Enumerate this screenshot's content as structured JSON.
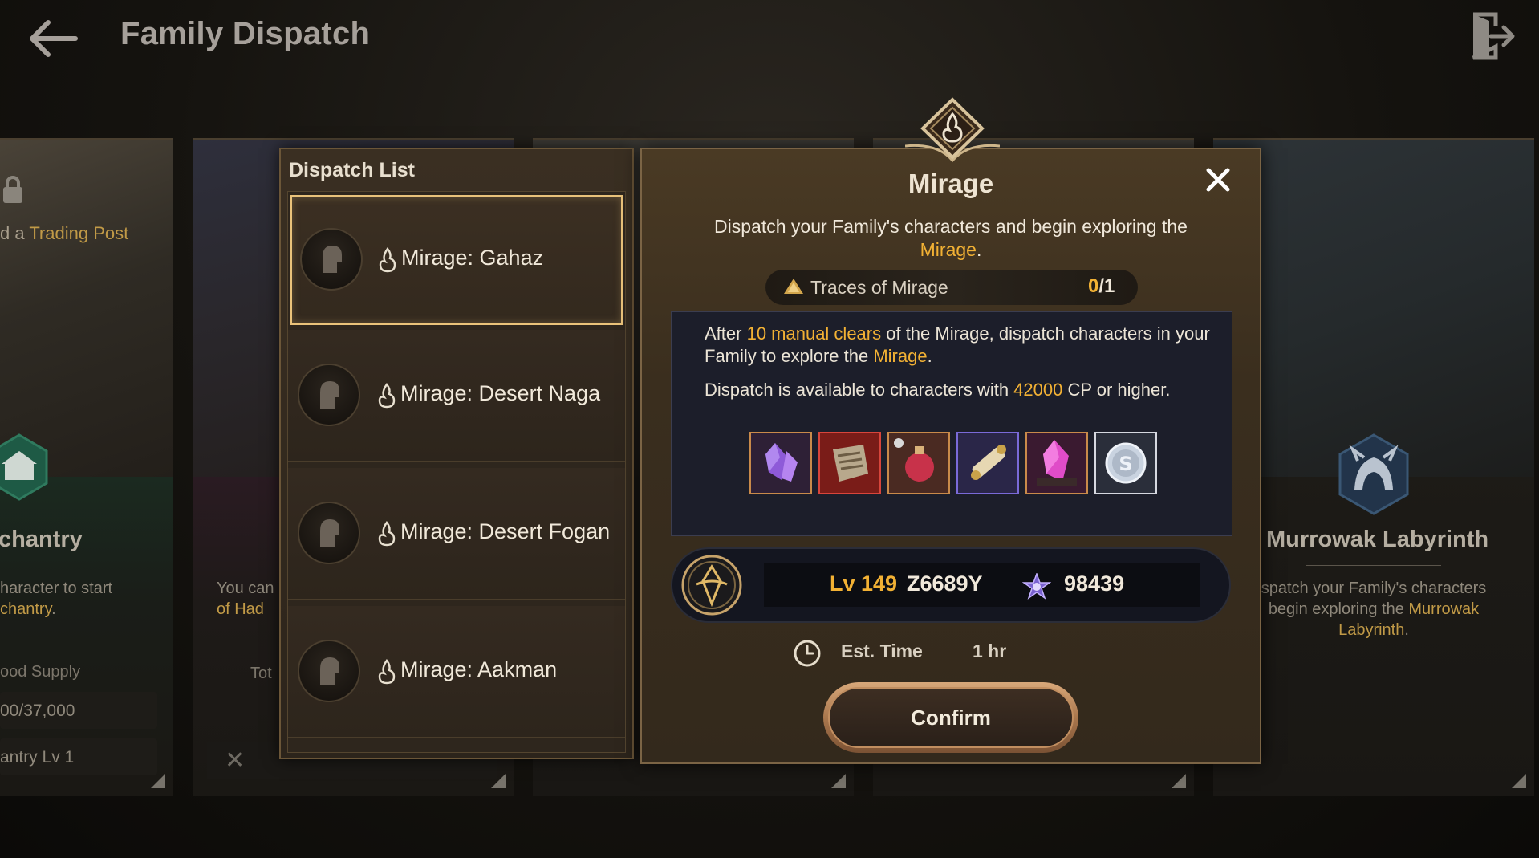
{
  "header": {
    "title": "Family Dispatch"
  },
  "background_cards": {
    "left": {
      "trading_prefix": "d a ",
      "trading_highlight": "Trading Post",
      "name": "chantry",
      "desc_line1": "haracter to start",
      "desc_line2_highlight": "chantry",
      "desc_line2_suffix": ".",
      "food_label": "ood Supply",
      "food_value": "00/37,000",
      "level": "antry Lv 1"
    },
    "middle": {
      "desc_line1_prefix": "You can",
      "desc_line2_prefix": "of Had",
      "tot_label": "Tot"
    },
    "right": {
      "name": "Murrowak Labyrinth",
      "desc_prefix": "spatch your Family's characters begin exploring the ",
      "desc_highlight": "Murrowak Labyrinth",
      "desc_suffix": "."
    }
  },
  "dispatch_list": {
    "title": "Dispatch List",
    "items": [
      {
        "label": "Mirage: Gahaz",
        "selected": true
      },
      {
        "label": "Mirage: Desert Naga",
        "selected": false
      },
      {
        "label": "Mirage: Desert Fogan",
        "selected": false
      },
      {
        "label": "Mirage: Aakman",
        "selected": false
      }
    ]
  },
  "detail": {
    "title": "Mirage",
    "subtitle_prefix": "Dispatch your Family's characters and begin exploring the",
    "subtitle_highlight": "Mirage",
    "subtitle_suffix": ".",
    "traces": {
      "label": "Traces of Mirage",
      "current": "0",
      "total": "/1"
    },
    "info": {
      "line1_prefix": "After ",
      "line1_highlight": "10 manual clears",
      "line1_mid": " of the Mirage, dispatch characters in your Family to explore the ",
      "line1_highlight2": "Mirage",
      "line1_suffix": ".",
      "line2_prefix": "Dispatch is available to characters with ",
      "line2_highlight": "42000",
      "line2_suffix": " CP or higher."
    },
    "rewards": [
      {
        "icon": "purple-crystal-icon",
        "border": "#c98a4a"
      },
      {
        "icon": "ancient-relic-icon",
        "border": "#d8453b"
      },
      {
        "icon": "red-potion-icon",
        "border": "#c98a4a"
      },
      {
        "icon": "scroll-icon",
        "border": "#7a6ad8"
      },
      {
        "icon": "pink-crystal-icon",
        "border": "#c98a4a"
      },
      {
        "icon": "silver-coin-icon",
        "border": "#d6d8e0"
      }
    ],
    "character": {
      "level_prefix": "Lv ",
      "level": "149",
      "name": "Z6689Y",
      "cp": "98439"
    },
    "est_time": {
      "label": "Est. Time",
      "value": "1 hr"
    },
    "confirm_label": "Confirm"
  },
  "colors": {
    "accent": "#f2b134",
    "selected_border": "#e9c27a",
    "panel_border": "#7b6445"
  }
}
